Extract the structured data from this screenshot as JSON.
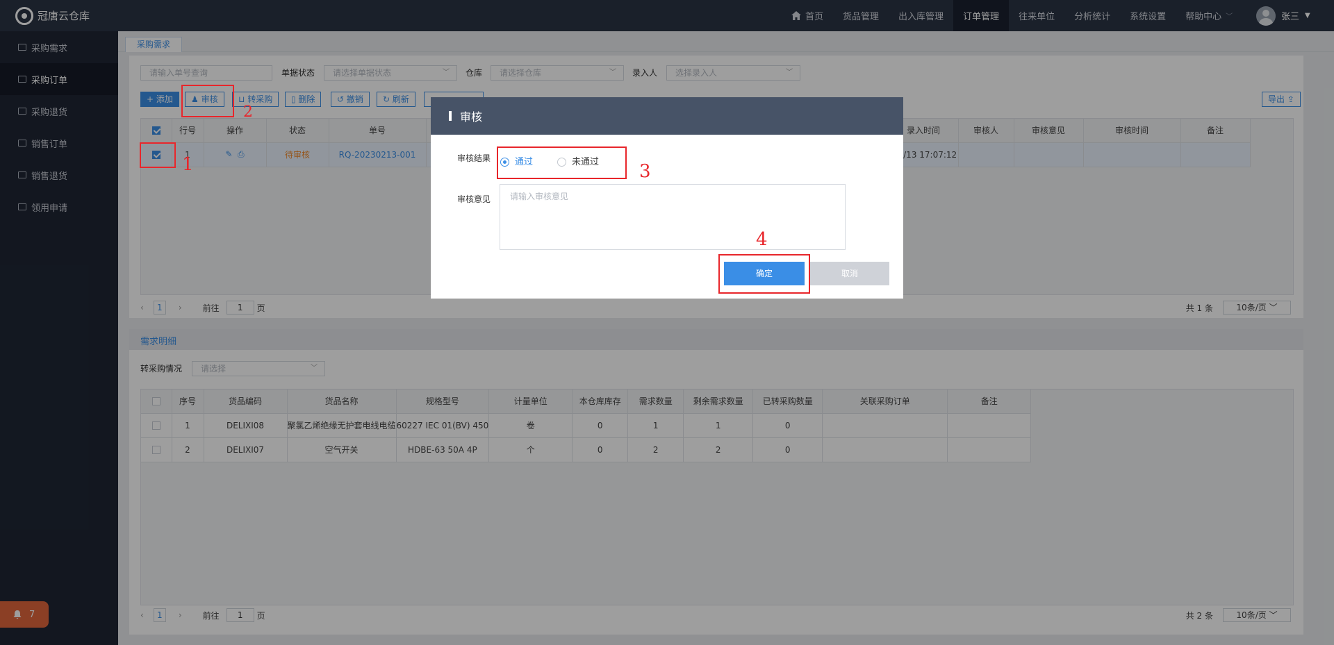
{
  "app": {
    "name": "冠唐云仓库"
  },
  "nav": [
    {
      "label": "首页"
    },
    {
      "label": "货品管理"
    },
    {
      "label": "出入库管理"
    },
    {
      "label": "订单管理",
      "active": true
    },
    {
      "label": "往来单位"
    },
    {
      "label": "分析统计"
    },
    {
      "label": "系统设置"
    },
    {
      "label": "帮助中心"
    }
  ],
  "user": {
    "name": "张三"
  },
  "sidebar": [
    {
      "label": "采购需求"
    },
    {
      "label": "采购订单",
      "active": true
    },
    {
      "label": "采购退货"
    },
    {
      "label": "销售订单"
    },
    {
      "label": "销售退货"
    },
    {
      "label": "领用申请"
    }
  ],
  "notif_count": "7",
  "tab": "采购需求",
  "filters": {
    "order_placeholder": "请输入单号查询",
    "status_label": "单据状态",
    "status_placeholder": "请选择单据状态",
    "warehouse_label": "仓库",
    "warehouse_placeholder": "请选择仓库",
    "creator_label": "录入人",
    "creator_placeholder": "选择录入人"
  },
  "toolbar": {
    "add": "+ 添加",
    "audit": "审核",
    "convert": "转采购",
    "delete": "删除",
    "revoke": "撤销",
    "refresh": "刷新",
    "export": "导出"
  },
  "top_table": {
    "headers_left": [
      "行号",
      "操作",
      "状态",
      "单号"
    ],
    "headers_right": [
      "录入时间",
      "审核人",
      "审核意见",
      "审核时间",
      "备注"
    ],
    "row": {
      "num": "1",
      "status": "待审核",
      "order_no": "RQ-20230213-001",
      "time": "3/2/13 17:07:12"
    }
  },
  "pager_top": {
    "page": "1",
    "goto": "前往",
    "goto_val": "1",
    "page_unit": "页",
    "total": "共 1 条",
    "size": "10条/页"
  },
  "detail": {
    "section_title": "需求明细",
    "filter_label": "转采购情况",
    "filter_placeholder": "请选择",
    "headers": [
      "序号",
      "货品编码",
      "货品名称",
      "规格型号",
      "计量单位",
      "本仓库库存",
      "需求数量",
      "剩余需求数量",
      "已转采购数量",
      "关联采购订单",
      "备注"
    ],
    "rows": [
      [
        "1",
        "DELIXI08",
        "聚氯乙烯绝缘无护套电线电缆",
        "60227 IEC 01(BV) 450",
        "卷",
        "0",
        "1",
        "1",
        "0",
        "",
        ""
      ],
      [
        "2",
        "DELIXI07",
        "空气开关",
        "HDBE-63 50A 4P",
        "个",
        "0",
        "2",
        "2",
        "0",
        "",
        ""
      ]
    ]
  },
  "pager_bottom": {
    "page": "1",
    "goto": "前往",
    "goto_val": "1",
    "page_unit": "页",
    "total": "共 2 条",
    "size": "10条/页"
  },
  "modal": {
    "title": "审核",
    "result_label": "审核结果",
    "opt_pass": "通过",
    "opt_fail": "未通过",
    "comment_label": "审核意见",
    "comment_placeholder": "请输入审核意见",
    "confirm": "确定",
    "cancel": "取消"
  },
  "annotations": [
    "1",
    "2",
    "3",
    "4"
  ],
  "colors": {
    "accent": "#3a8ee6",
    "topbar": "#2b3445",
    "sidebar": "#1f2635",
    "annotation": "#e8262b",
    "pending": "#f08a2c"
  }
}
